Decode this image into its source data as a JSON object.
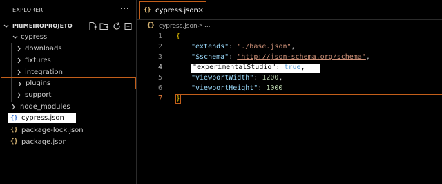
{
  "sidebar": {
    "title": "EXPLORER",
    "more_label": "···",
    "project": {
      "name": "PRIMEIROPROJETO",
      "actions": [
        "new-file-icon",
        "new-folder-icon",
        "refresh-icon",
        "collapse-all-icon"
      ]
    },
    "tree": [
      {
        "label": "cypress",
        "type": "folder",
        "expanded": true
      },
      {
        "label": "downloads",
        "type": "folder"
      },
      {
        "label": "fixtures",
        "type": "folder"
      },
      {
        "label": "integration",
        "type": "folder"
      },
      {
        "label": "plugins",
        "type": "folder",
        "selected": true
      },
      {
        "label": "support",
        "type": "folder"
      },
      {
        "label": "node_modules",
        "type": "folder"
      },
      {
        "label": "cypress.json",
        "type": "file",
        "icon": "{}",
        "active": true
      },
      {
        "label": "package-lock.json",
        "type": "file",
        "icon": "{}"
      },
      {
        "label": "package.json",
        "type": "file",
        "icon": "{}"
      }
    ]
  },
  "editor": {
    "tab": {
      "icon": "{}",
      "label": "cypress.json",
      "close": "×"
    },
    "breadcrumb": {
      "icon": "{}",
      "file": "cypress.json",
      "sep": ">",
      "more": "..."
    },
    "lines": [
      {
        "n": "1",
        "text": "{"
      },
      {
        "n": "2",
        "key": "\"extends\"",
        "value": "\"./base.json\"",
        "trail": ","
      },
      {
        "n": "3",
        "key": "\"$schema\"",
        "value": "\"http://json-schema.org/schema\"",
        "trail": ","
      },
      {
        "n": "4",
        "key": "\"experimentalStudio\"",
        "value": "true",
        "trail": ","
      },
      {
        "n": "5",
        "key": "\"viewportWidth\"",
        "value": "1200",
        "trail": ","
      },
      {
        "n": "6",
        "key": "\"viewportHeight\"",
        "value": "1000",
        "trail": ""
      },
      {
        "n": "7",
        "text": "}"
      }
    ]
  },
  "colors": {
    "accent_border": "#c25e1a",
    "json_icon": "#e5c07b",
    "key": "#9cdcfe",
    "string": "#ce9178",
    "number": "#b5cea8",
    "boolean": "#569cd6"
  }
}
